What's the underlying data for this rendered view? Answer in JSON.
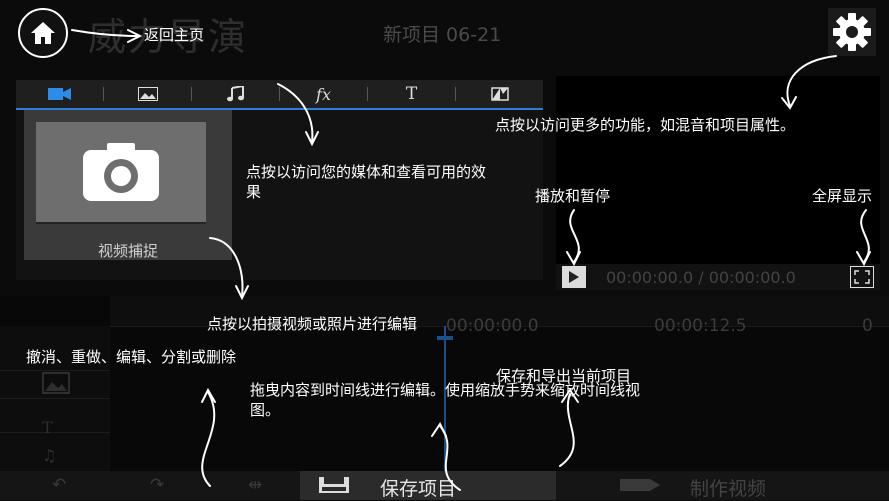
{
  "header": {
    "app_title": "威力导演",
    "project_title": "新项目 06-21"
  },
  "media_tabs": [
    {
      "icon": "video-camera-icon"
    },
    {
      "icon": "image-icon"
    },
    {
      "icon": "music-note-icon"
    },
    {
      "icon": "fx-icon",
      "label": "fx"
    },
    {
      "icon": "title-text-icon",
      "label": "T"
    },
    {
      "icon": "transition-icon"
    }
  ],
  "capture": {
    "label": "视频捕捉"
  },
  "preview": {
    "timecode": "00:00:00.0 / 00:00:00.0"
  },
  "timeline": {
    "ticks": [
      "00:00:00.0",
      "00:00:12.5",
      "0"
    ]
  },
  "bottom_bar": {
    "save_label": "保存项目",
    "produce_label": "制作视频"
  },
  "tutorial_notes": {
    "home": "返回主页",
    "settings": "点按以访问更多的功能，如混音和项目属性。",
    "media": "点按以访问您的媒体和查看可用的效果",
    "capture": "点按以拍摄视频或照片进行编辑",
    "play": "播放和暂停",
    "fullscreen": "全屏显示",
    "edit_tools": "撤消、重做、编辑、分割或删除",
    "timeline": "拖曳内容到时间线进行编辑。使用缩放手势来缩放时间线视图。",
    "save": "保存和导出当前项目"
  }
}
